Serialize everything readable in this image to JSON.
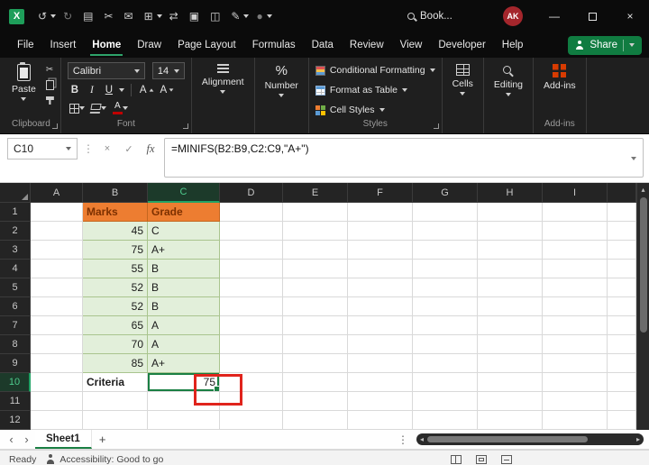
{
  "colors": {
    "accent_green": "#107C41",
    "header_orange": "#ED7D31",
    "data_fill_green": "#E2EFDA",
    "annotation_red": "#E0241C"
  },
  "title_bar": {
    "icons": [
      "↺",
      "↻",
      "▤",
      "✂",
      "✉",
      "⊞",
      "⇄",
      "▣",
      "◫",
      "✎",
      "●"
    ],
    "doc_name": "Book...",
    "avatar": "AK",
    "minimize": "—",
    "close": "×"
  },
  "menu": {
    "tabs": [
      "File",
      "Insert",
      "Home",
      "Draw",
      "Page Layout",
      "Formulas",
      "Data",
      "Review",
      "View",
      "Developer",
      "Help"
    ],
    "active_tab": "Home",
    "share": "Share"
  },
  "ribbon": {
    "paste": "Paste",
    "clipboard_label": "Clipboard",
    "cut_icon": "✂",
    "font_name": "Calibri",
    "font_size": "14",
    "bold": "B",
    "italic": "I",
    "underline": "U",
    "grow_font": "A",
    "shrink_font": "A",
    "font_color": "A",
    "font_label": "Font",
    "alignment_label": "Alignment",
    "percent_icon": "%",
    "number_label": "Number",
    "conditional_formatting": "Conditional Formatting",
    "format_as_table": "Format as Table",
    "cell_styles": "Cell Styles",
    "styles_label": "Styles",
    "cells_label": "Cells",
    "editing_label": "Editing",
    "addins_label": "Add-ins"
  },
  "formula_bar": {
    "name_box": "C10",
    "menu_dots": "⋮",
    "cancel": "×",
    "enter": "✓",
    "fx": "fx",
    "formula": "=MINIFS(B2:B9,C2:C9,\"A+\")"
  },
  "grid": {
    "cols": [
      "A",
      "B",
      "C",
      "D",
      "E",
      "F",
      "G",
      "H",
      "I"
    ],
    "selected_cell": "C10",
    "scroll_up": "▴",
    "rows": [
      {
        "n": "1",
        "b": "Marks",
        "c": "Grade"
      },
      {
        "n": "2",
        "b": "45",
        "c": "C"
      },
      {
        "n": "3",
        "b": "75",
        "c": "A+"
      },
      {
        "n": "4",
        "b": "55",
        "c": "B"
      },
      {
        "n": "5",
        "b": "52",
        "c": "B"
      },
      {
        "n": "6",
        "b": "52",
        "c": "B"
      },
      {
        "n": "7",
        "b": "65",
        "c": "A"
      },
      {
        "n": "8",
        "b": "70",
        "c": "A"
      },
      {
        "n": "9",
        "b": "85",
        "c": "A+"
      },
      {
        "n": "10",
        "b": "Criteria",
        "c": "75"
      },
      {
        "n": "11",
        "b": "",
        "c": ""
      },
      {
        "n": "12",
        "b": "",
        "c": ""
      }
    ]
  },
  "sheet_tabs": {
    "prev": "‹",
    "next": "›",
    "sheet1": "Sheet1",
    "add": "+",
    "menu_dots": "⋮",
    "hscroll_left": "◂",
    "hscroll_right": "▸"
  },
  "status_bar": {
    "ready": "Ready",
    "accessibility": "Accessibility: Good to go"
  }
}
